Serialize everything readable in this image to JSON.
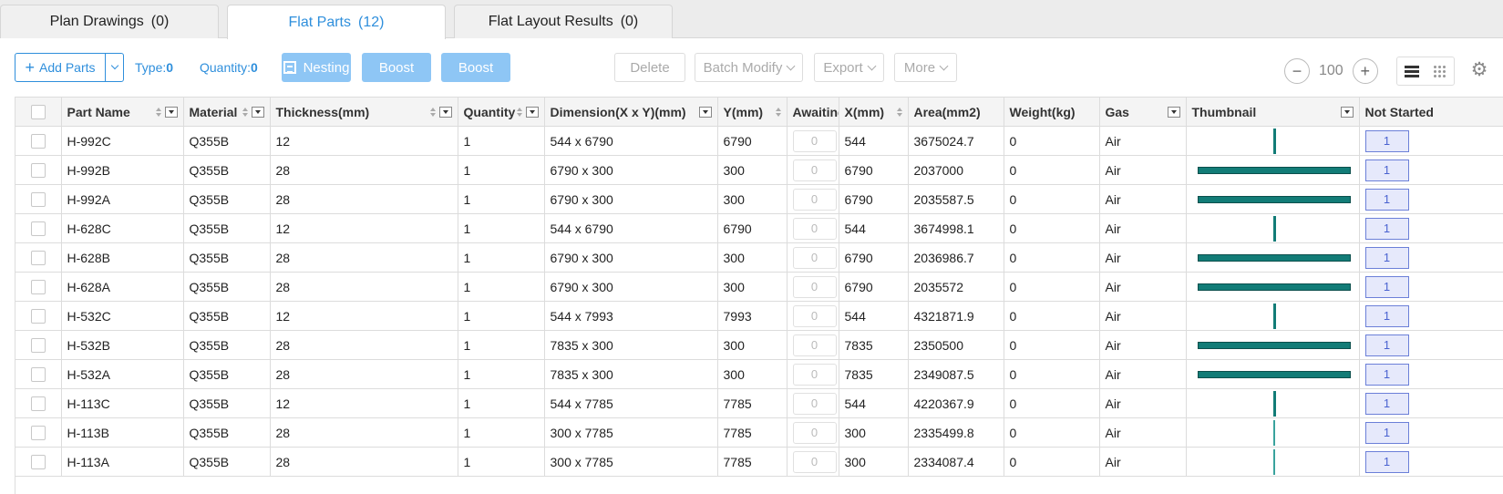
{
  "tabs": [
    {
      "label": "Plan Drawings",
      "count": "(0)",
      "active": false
    },
    {
      "label": "Flat Parts",
      "count": "(12)",
      "active": true
    },
    {
      "label": "Flat Layout Results",
      "count": "(0)",
      "active": false
    }
  ],
  "toolbar": {
    "add_parts": "Add Parts",
    "type_label": "Type:",
    "type_value": "0",
    "quantity_label": "Quantity:",
    "quantity_value": "0",
    "nesting": "Nesting",
    "boost1": "Boost",
    "boost2": "Boost",
    "delete": "Delete",
    "batch_modify": "Batch Modify",
    "export": "Export",
    "more": "More",
    "zoom_value": "100"
  },
  "table": {
    "columns": [
      "Part Name",
      "Material",
      "Thickness(mm)",
      "Quantity",
      "Dimension(X x Y)(mm)",
      "Y(mm)",
      "Awaiting",
      "X(mm)",
      "Area(mm2)",
      "Weight(kg)",
      "Gas",
      "Thumbnail",
      "Not Started"
    ],
    "rows": [
      {
        "name": "H-992C",
        "material": "Q355B",
        "thickness": "12",
        "quantity": "1",
        "dimension": "544 x 6790",
        "y": "6790",
        "awaiting": "0",
        "x": "544",
        "area": "3675024.7",
        "weight": "0",
        "gas": "Air",
        "thumb": "v",
        "not_started": "1"
      },
      {
        "name": "H-992B",
        "material": "Q355B",
        "thickness": "28",
        "quantity": "1",
        "dimension": "6790 x 300",
        "y": "300",
        "awaiting": "0",
        "x": "6790",
        "area": "2037000",
        "weight": "0",
        "gas": "Air",
        "thumb": "h",
        "not_started": "1"
      },
      {
        "name": "H-992A",
        "material": "Q355B",
        "thickness": "28",
        "quantity": "1",
        "dimension": "6790 x 300",
        "y": "300",
        "awaiting": "0",
        "x": "6790",
        "area": "2035587.5",
        "weight": "0",
        "gas": "Air",
        "thumb": "h",
        "not_started": "1"
      },
      {
        "name": "H-628C",
        "material": "Q355B",
        "thickness": "12",
        "quantity": "1",
        "dimension": "544 x 6790",
        "y": "6790",
        "awaiting": "0",
        "x": "544",
        "area": "3674998.1",
        "weight": "0",
        "gas": "Air",
        "thumb": "v",
        "not_started": "1"
      },
      {
        "name": "H-628B",
        "material": "Q355B",
        "thickness": "28",
        "quantity": "1",
        "dimension": "6790 x 300",
        "y": "300",
        "awaiting": "0",
        "x": "6790",
        "area": "2036986.7",
        "weight": "0",
        "gas": "Air",
        "thumb": "h",
        "not_started": "1"
      },
      {
        "name": "H-628A",
        "material": "Q355B",
        "thickness": "28",
        "quantity": "1",
        "dimension": "6790 x 300",
        "y": "300",
        "awaiting": "0",
        "x": "6790",
        "area": "2035572",
        "weight": "0",
        "gas": "Air",
        "thumb": "h",
        "not_started": "1"
      },
      {
        "name": "H-532C",
        "material": "Q355B",
        "thickness": "12",
        "quantity": "1",
        "dimension": "544 x 7993",
        "y": "7993",
        "awaiting": "0",
        "x": "544",
        "area": "4321871.9",
        "weight": "0",
        "gas": "Air",
        "thumb": "v",
        "not_started": "1"
      },
      {
        "name": "H-532B",
        "material": "Q355B",
        "thickness": "28",
        "quantity": "1",
        "dimension": "7835 x 300",
        "y": "300",
        "awaiting": "0",
        "x": "7835",
        "area": "2350500",
        "weight": "0",
        "gas": "Air",
        "thumb": "h",
        "not_started": "1"
      },
      {
        "name": "H-532A",
        "material": "Q355B",
        "thickness": "28",
        "quantity": "1",
        "dimension": "7835 x 300",
        "y": "300",
        "awaiting": "0",
        "x": "7835",
        "area": "2349087.5",
        "weight": "0",
        "gas": "Air",
        "thumb": "h",
        "not_started": "1"
      },
      {
        "name": "H-113C",
        "material": "Q355B",
        "thickness": "12",
        "quantity": "1",
        "dimension": "544 x 7785",
        "y": "7785",
        "awaiting": "0",
        "x": "544",
        "area": "4220367.9",
        "weight": "0",
        "gas": "Air",
        "thumb": "v",
        "not_started": "1"
      },
      {
        "name": "H-113B",
        "material": "Q355B",
        "thickness": "28",
        "quantity": "1",
        "dimension": "300 x 7785",
        "y": "7785",
        "awaiting": "0",
        "x": "300",
        "area": "2335499.8",
        "weight": "0",
        "gas": "Air",
        "thumb": "vt",
        "not_started": "1"
      },
      {
        "name": "H-113A",
        "material": "Q355B",
        "thickness": "28",
        "quantity": "1",
        "dimension": "300 x 7785",
        "y": "7785",
        "awaiting": "0",
        "x": "300",
        "area": "2334087.4",
        "weight": "0",
        "gas": "Air",
        "thumb": "vt",
        "not_started": "1"
      }
    ]
  },
  "colors": {
    "accent": "#2f8fdc",
    "boost": "#8ec6f5",
    "thumbnail": "#127c77",
    "not_started": "#6b7fd8"
  },
  "icons": [
    "plus-icon",
    "chevron-down-icon",
    "nesting-icon",
    "minus-icon",
    "plus-icon",
    "list-view-icon",
    "grid-view-icon",
    "gear-icon",
    "sort-icon",
    "filter-icon"
  ]
}
